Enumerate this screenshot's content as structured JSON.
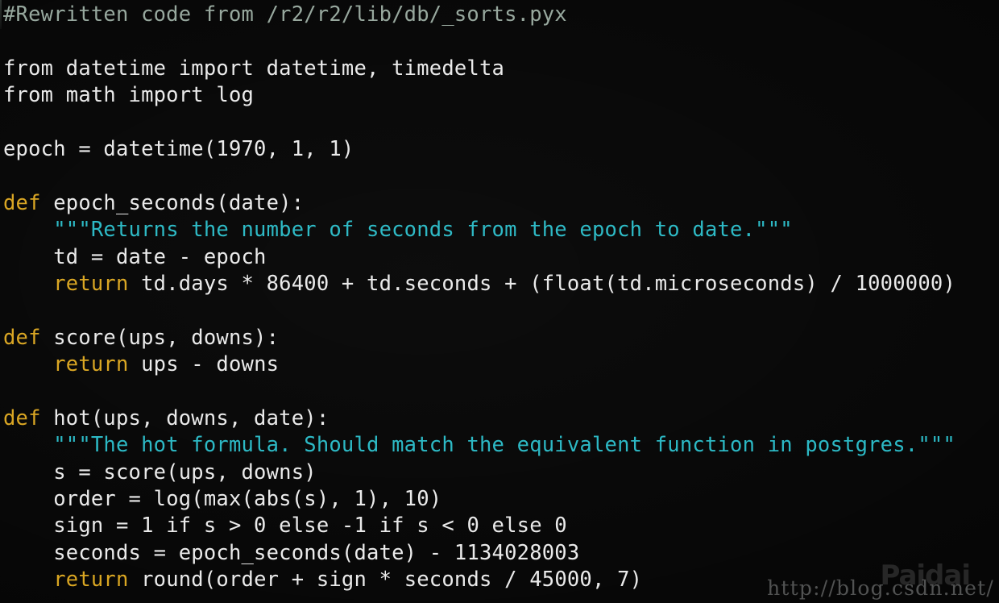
{
  "editor": {
    "background_color": "#050505",
    "default_text_color": "#eaeaea",
    "language": "python",
    "colors": {
      "comment": "#96a79d",
      "keyword": "#d9a520",
      "string": "#29b8c4",
      "plain": "#eaeaea"
    }
  },
  "lines": [
    {
      "id": "line-1",
      "indent": "",
      "type": "comment",
      "text": "#Rewritten code from /r2/r2/lib/db/_sorts.pyx"
    },
    {
      "id": "line-2",
      "indent": "",
      "type": "blank",
      "text": ""
    },
    {
      "id": "line-3",
      "indent": "",
      "type": "code",
      "keyword": "",
      "text": "from datetime import datetime, timedelta"
    },
    {
      "id": "line-4",
      "indent": "",
      "type": "code",
      "keyword": "",
      "text": "from math import log"
    },
    {
      "id": "line-5",
      "indent": "",
      "type": "blank",
      "text": ""
    },
    {
      "id": "line-6",
      "indent": "",
      "type": "code",
      "keyword": "",
      "text": "epoch = datetime(1970, 1, 1)"
    },
    {
      "id": "line-7",
      "indent": "",
      "type": "blank",
      "text": ""
    },
    {
      "id": "line-8",
      "indent": "",
      "type": "code",
      "keyword": "def",
      "text": " epoch_seconds(date):"
    },
    {
      "id": "line-9",
      "indent": "    ",
      "type": "docstring",
      "text": "\"\"\"Returns the number of seconds from the epoch to date.\"\"\""
    },
    {
      "id": "line-10",
      "indent": "    ",
      "type": "code",
      "keyword": "",
      "text": "td = date - epoch"
    },
    {
      "id": "line-11",
      "indent": "    ",
      "type": "code",
      "keyword": "return",
      "text": " td.days * 86400 + td.seconds + (float(td.microseconds) / 1000000)"
    },
    {
      "id": "line-12",
      "indent": "",
      "type": "blank",
      "text": ""
    },
    {
      "id": "line-13",
      "indent": "",
      "type": "code",
      "keyword": "def",
      "text": " score(ups, downs):"
    },
    {
      "id": "line-14",
      "indent": "    ",
      "type": "code",
      "keyword": "return",
      "text": " ups - downs"
    },
    {
      "id": "line-15",
      "indent": "",
      "type": "blank",
      "text": ""
    },
    {
      "id": "line-16",
      "indent": "",
      "type": "code",
      "keyword": "def",
      "text": " hot(ups, downs, date):"
    },
    {
      "id": "line-17",
      "indent": "    ",
      "type": "docstring",
      "text": "\"\"\"The hot formula. Should match the equivalent function in postgres.\"\"\""
    },
    {
      "id": "line-18",
      "indent": "    ",
      "type": "code",
      "keyword": "",
      "text": "s = score(ups, downs)"
    },
    {
      "id": "line-19",
      "indent": "    ",
      "type": "code",
      "keyword": "",
      "text": "order = log(max(abs(s), 1), 10)"
    },
    {
      "id": "line-20",
      "indent": "    ",
      "type": "code",
      "keyword": "",
      "text": "sign = 1 if s > 0 else -1 if s < 0 else 0"
    },
    {
      "id": "line-21",
      "indent": "    ",
      "type": "code",
      "keyword": "",
      "text": "seconds = epoch_seconds(date) - 1134028003"
    },
    {
      "id": "line-22",
      "indent": "    ",
      "type": "code",
      "keyword": "return",
      "text": " round(order + sign * seconds / 45000, 7)"
    }
  ],
  "watermark": {
    "url": "http://blog.csdn.net/",
    "badge": "Paidai"
  }
}
